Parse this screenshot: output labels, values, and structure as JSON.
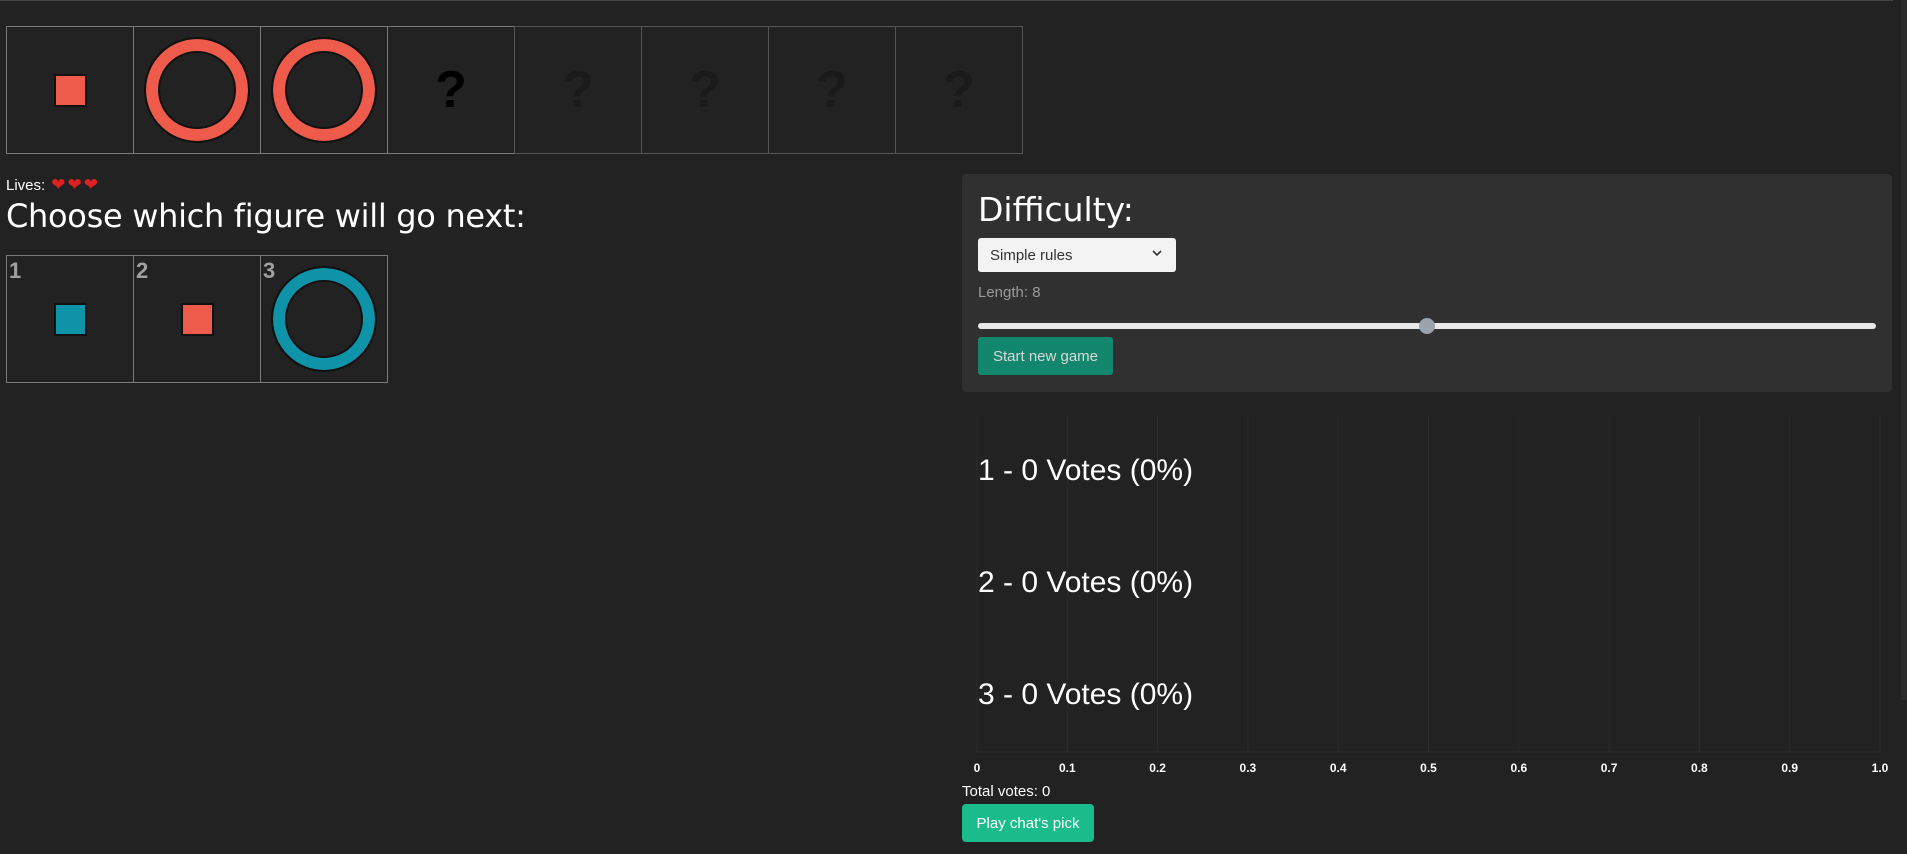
{
  "sequence": [
    {
      "kind": "square",
      "color": "#ef5b4b"
    },
    {
      "kind": "ring",
      "color": "#ef5b4b"
    },
    {
      "kind": "ring",
      "color": "#ef5b4b"
    },
    {
      "kind": "question",
      "symbol": "?",
      "active": true
    },
    {
      "kind": "question",
      "symbol": "?",
      "active": false
    },
    {
      "kind": "question",
      "symbol": "?",
      "active": false
    },
    {
      "kind": "question",
      "symbol": "?",
      "active": false
    },
    {
      "kind": "question",
      "symbol": "?",
      "active": false
    }
  ],
  "lives": {
    "label": "Lives:",
    "count": 3,
    "icon": "heart-icon"
  },
  "prompt": "Choose which figure will go next:",
  "choices": [
    {
      "number": "1",
      "kind": "square",
      "color": "#0f93a8"
    },
    {
      "number": "2",
      "kind": "square",
      "color": "#ef5b4b"
    },
    {
      "number": "3",
      "kind": "ring",
      "color": "#0f93a8"
    }
  ],
  "difficulty": {
    "title": "Difficulty:",
    "selected": "Simple rules",
    "length_label": "Length: 8",
    "slider_fraction": 0.5,
    "start_label": "Start new game"
  },
  "chart_data": {
    "type": "bar",
    "orientation": "horizontal",
    "categories": [
      "1",
      "2",
      "3"
    ],
    "values": [
      0,
      0,
      0
    ],
    "data_labels": [
      "1 - 0 Votes (0%)",
      "2 - 0 Votes (0%)",
      "3 - 0 Votes (0%)"
    ],
    "xlim": [
      0,
      1
    ],
    "x_ticks": [
      "0",
      "0.1",
      "0.2",
      "0.3",
      "0.4",
      "0.5",
      "0.6",
      "0.7",
      "0.8",
      "0.9",
      "1.0"
    ],
    "grid": true
  },
  "votes": {
    "total_label": "Total votes: 0",
    "play_label": "Play chat's pick"
  }
}
